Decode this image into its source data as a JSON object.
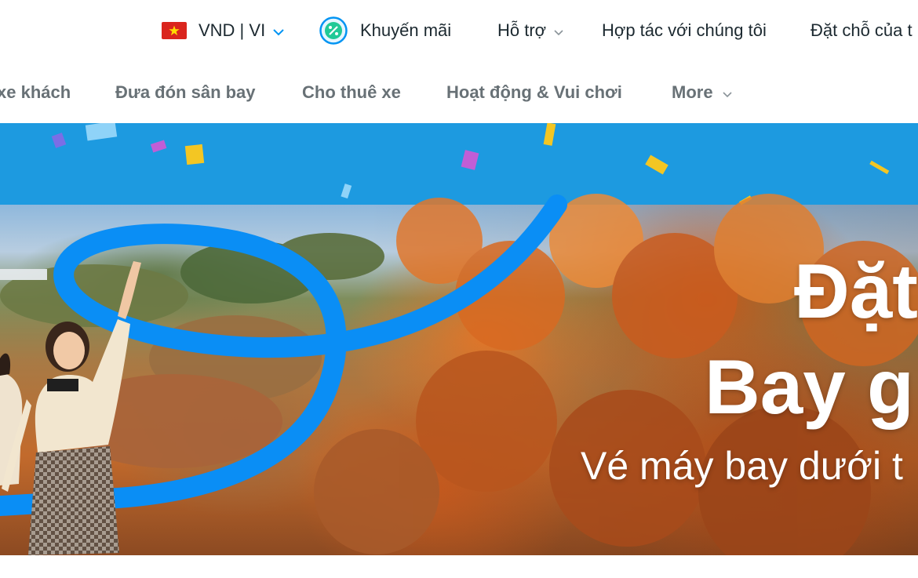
{
  "topbar": {
    "currency_language": "VND | VI",
    "promotions": "Khuyến mãi",
    "support": "Hỗ trợ",
    "partner": "Hợp tác với chúng tôi",
    "bookings": "Đặt chỗ của t"
  },
  "nav": {
    "items": [
      {
        "label": "xe khách"
      },
      {
        "label": "Đưa đón sân bay"
      },
      {
        "label": "Cho thuê xe"
      },
      {
        "label": "Hoạt động & Vui chơi"
      },
      {
        "label": "More"
      }
    ]
  },
  "hero": {
    "line1": "Đặt",
    "line2": "Bay g",
    "line3": "Vé máy bay dưới t"
  },
  "colors": {
    "brand_blue": "#1d9ae0",
    "ribbon_blue": "#0a8ef5",
    "promo_green": "#20c997",
    "text_dark": "#1c2930",
    "nav_gray": "#687176"
  },
  "icons": {
    "flag": "vietnam-flag-icon",
    "promo": "discount-badge-icon",
    "dropdown": "chevron-down-icon"
  }
}
